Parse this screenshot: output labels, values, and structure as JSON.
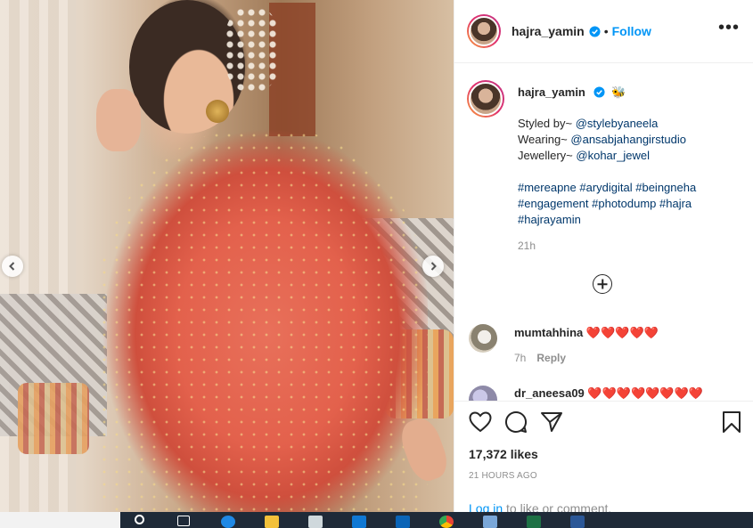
{
  "post": {
    "nav": {
      "prev_icon": "chevron-left-icon",
      "next_icon": "chevron-right-icon"
    }
  },
  "header": {
    "username": "hajra_yamin",
    "separator": "•",
    "follow_label": "Follow",
    "more_label": "•••"
  },
  "caption": {
    "username": "hajra_yamin",
    "emoji": "🐝",
    "lines": [
      {
        "prefix": "Styled by~ ",
        "mention": "@stylebyaneela"
      },
      {
        "prefix": "Wearing~ ",
        "mention": "@ansabjahangirstudio"
      },
      {
        "prefix": "Jewellery~ ",
        "mention": "@kohar_jewel"
      }
    ],
    "hashtags": "#mereapne #arydigital #beingneha #engagement #photodump #hajra #hajrayamin",
    "time": "21h"
  },
  "comments": [
    {
      "user": "mumtahhina",
      "text": "❤️❤️❤️❤️❤️",
      "time": "7h",
      "reply_label": "Reply"
    },
    {
      "user": "dr_aneesa09",
      "text": "❤️❤️❤️❤️❤️❤️❤️❤️"
    }
  ],
  "stats": {
    "likes": "17,372 likes",
    "posted": "21 HOURS AGO"
  },
  "login": {
    "link_text": "Log in",
    "rest_text": " to like or comment."
  },
  "colors": {
    "accent": "#0095f6",
    "heart": "#e0245e",
    "muted": "#8e8e8e"
  }
}
